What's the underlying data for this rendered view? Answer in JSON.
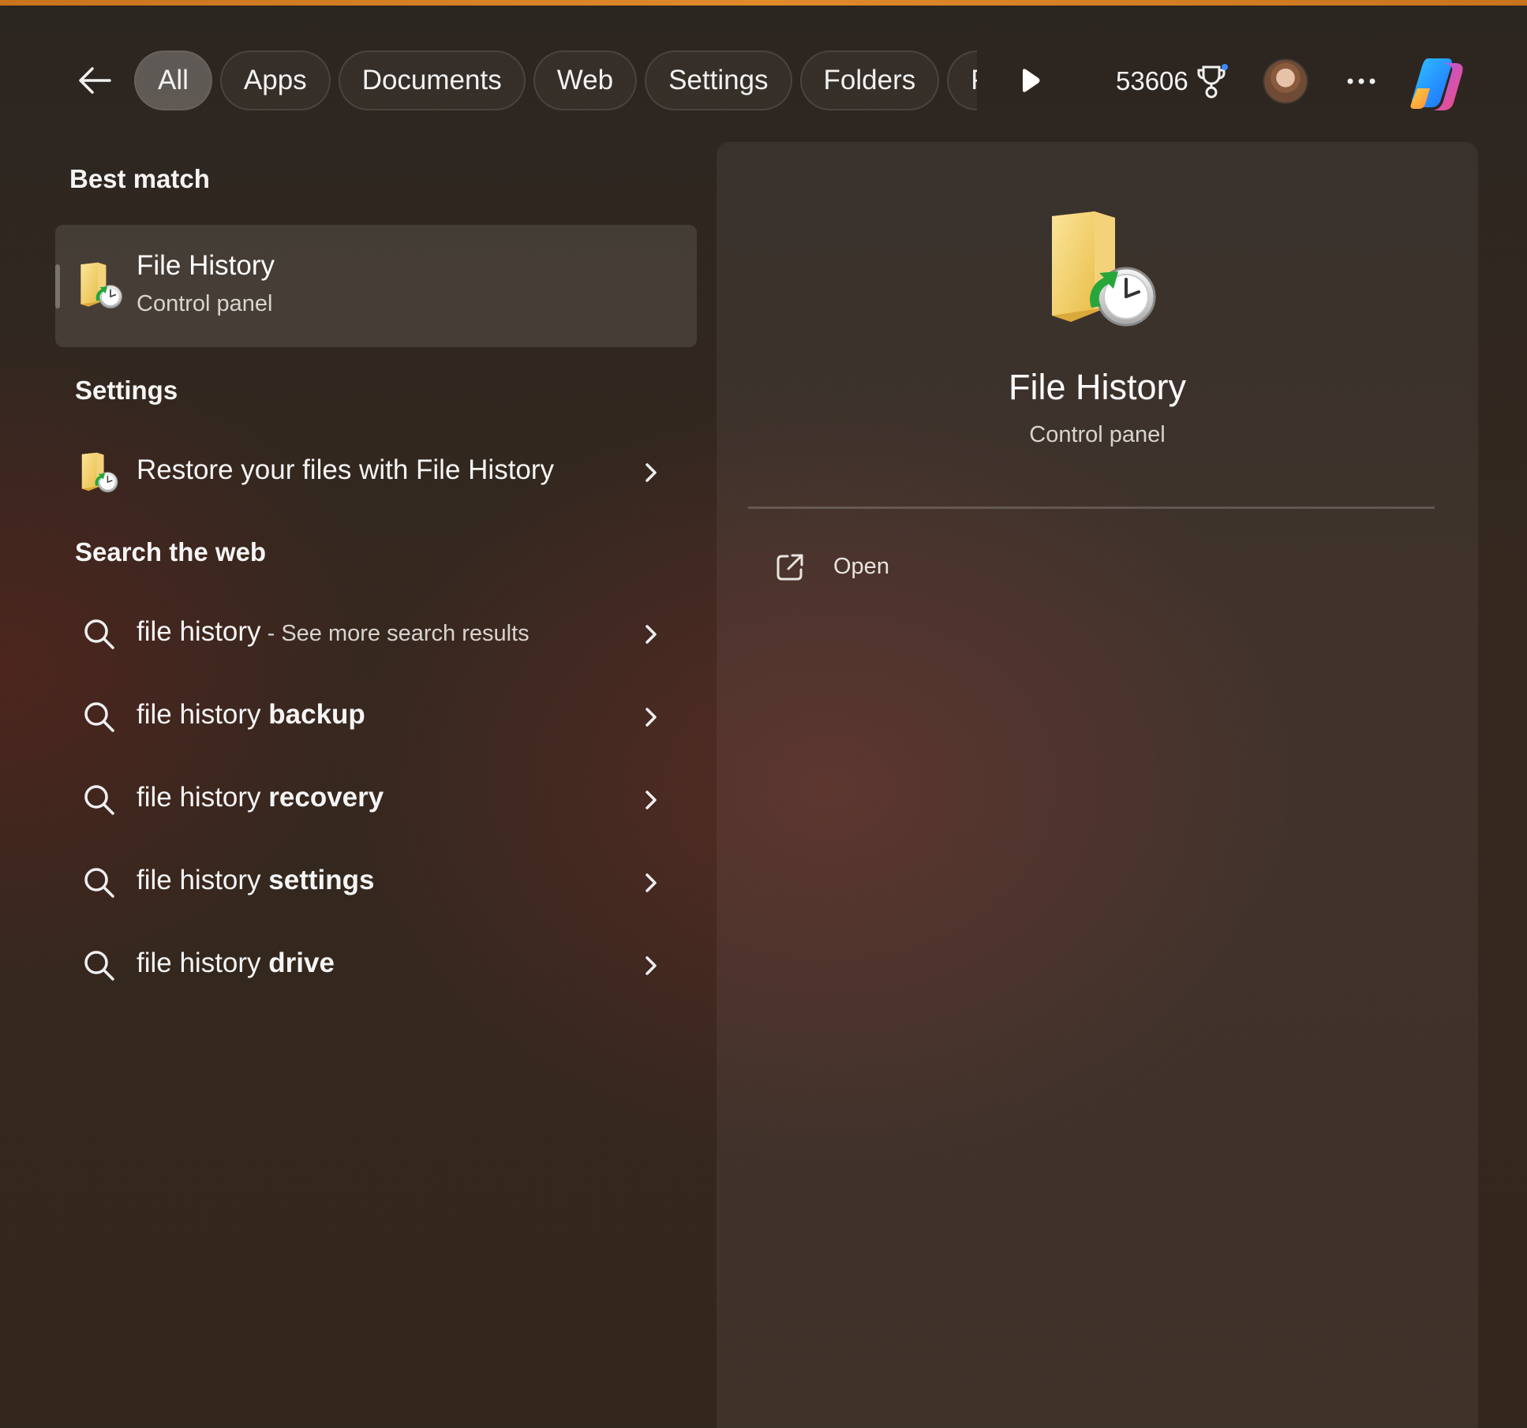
{
  "topbar": {
    "tabs": [
      "All",
      "Apps",
      "Documents",
      "Web",
      "Settings",
      "Folders",
      "People"
    ],
    "points": "53606"
  },
  "sections": {
    "best_match": "Best match",
    "settings": "Settings",
    "search_web": "Search the web"
  },
  "best_match": {
    "title": "File History",
    "subtitle": "Control panel"
  },
  "settings_items": [
    {
      "label": "Restore your files with File History"
    }
  ],
  "web_items": [
    {
      "query": "file history",
      "bold": "",
      "suffix": " - See more search results"
    },
    {
      "query": "file history ",
      "bold": "backup",
      "suffix": ""
    },
    {
      "query": "file history ",
      "bold": "recovery",
      "suffix": ""
    },
    {
      "query": "file history ",
      "bold": "settings",
      "suffix": ""
    },
    {
      "query": "file history ",
      "bold": "drive",
      "suffix": ""
    }
  ],
  "preview": {
    "title": "File History",
    "subtitle": "Control panel",
    "actions": [
      {
        "label": "Open"
      }
    ]
  },
  "icons": {
    "back": "back-arrow-icon",
    "play": "play-icon",
    "trophy": "trophy-icon",
    "more": "more-icon",
    "copilot": "copilot-icon",
    "search": "search-icon",
    "chevron": "chevron-right-icon",
    "open": "open-external-icon",
    "file_history": "file-history-icon"
  },
  "colors": {
    "accent_top": "#e08a2a",
    "text": "#ffffff",
    "muted_text": "#d8d4cf"
  }
}
